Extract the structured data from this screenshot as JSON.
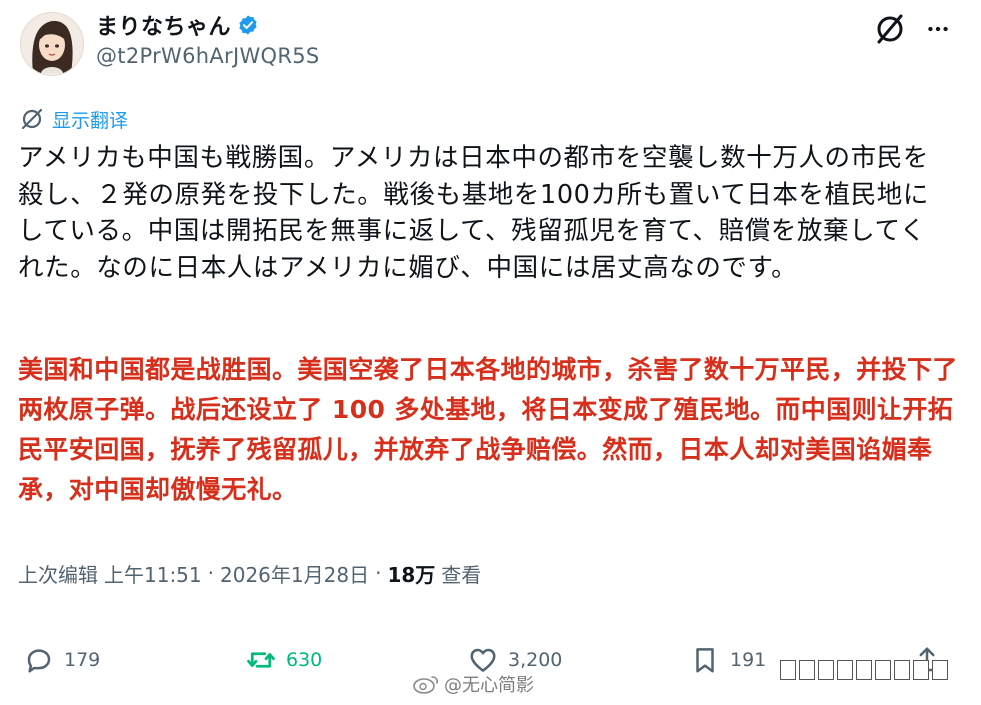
{
  "author": {
    "display_name": "まりなちゃん",
    "handle": "@t2PrW6hArJWQR5S",
    "verified": true
  },
  "translate_label": "显示翻译",
  "tweet_text": "アメリカも中国も戦勝国。アメリカは日本中の都市を空襲し数十万人の市民を殺し、２発の原発を投下した。戦後も基地を100カ所も置いて日本を植民地にしている。中国は開拓民を無事に返して、残留孤児を育て、賠償を放棄してくれた。なのに日本人はアメリカに媚び、中国には居丈高なのです。",
  "translation_text": "美国和中国都是战胜国。美国空袭了日本各地的城市，杀害了数十万平民，并投下了两枚原子弹。战后还设立了 100 多处基地，将日本变成了殖民地。而中国则让开拓民平安回国，抚养了残留孤儿，并放弃了战争赔偿。然而，日本人却对美国谄媚奉承，对中国却傲慢无礼。",
  "meta": {
    "edited_label": "上次编辑",
    "time": "上午11:51",
    "separator": "·",
    "date": "2026年1月28日",
    "views_count": "18万",
    "views_label": "查看"
  },
  "actions": {
    "replies": "179",
    "reposts": "630",
    "likes": "3,200",
    "bookmarks": "191"
  },
  "watermark": "@无心简影",
  "colors": {
    "text": "#0f1419",
    "secondary": "#536471",
    "link": "#1d9bf0",
    "repost": "#00ba7c",
    "translation": "#d6301c",
    "verified": "#1d9bf0"
  },
  "icons": {
    "verified": "verified-badge-icon",
    "grok": "grok-icon",
    "more": "more-icon",
    "translate": "translate-icon",
    "reply": "reply-icon",
    "repost": "repost-icon",
    "like": "like-icon",
    "bookmark": "bookmark-icon",
    "share": "share-icon"
  }
}
